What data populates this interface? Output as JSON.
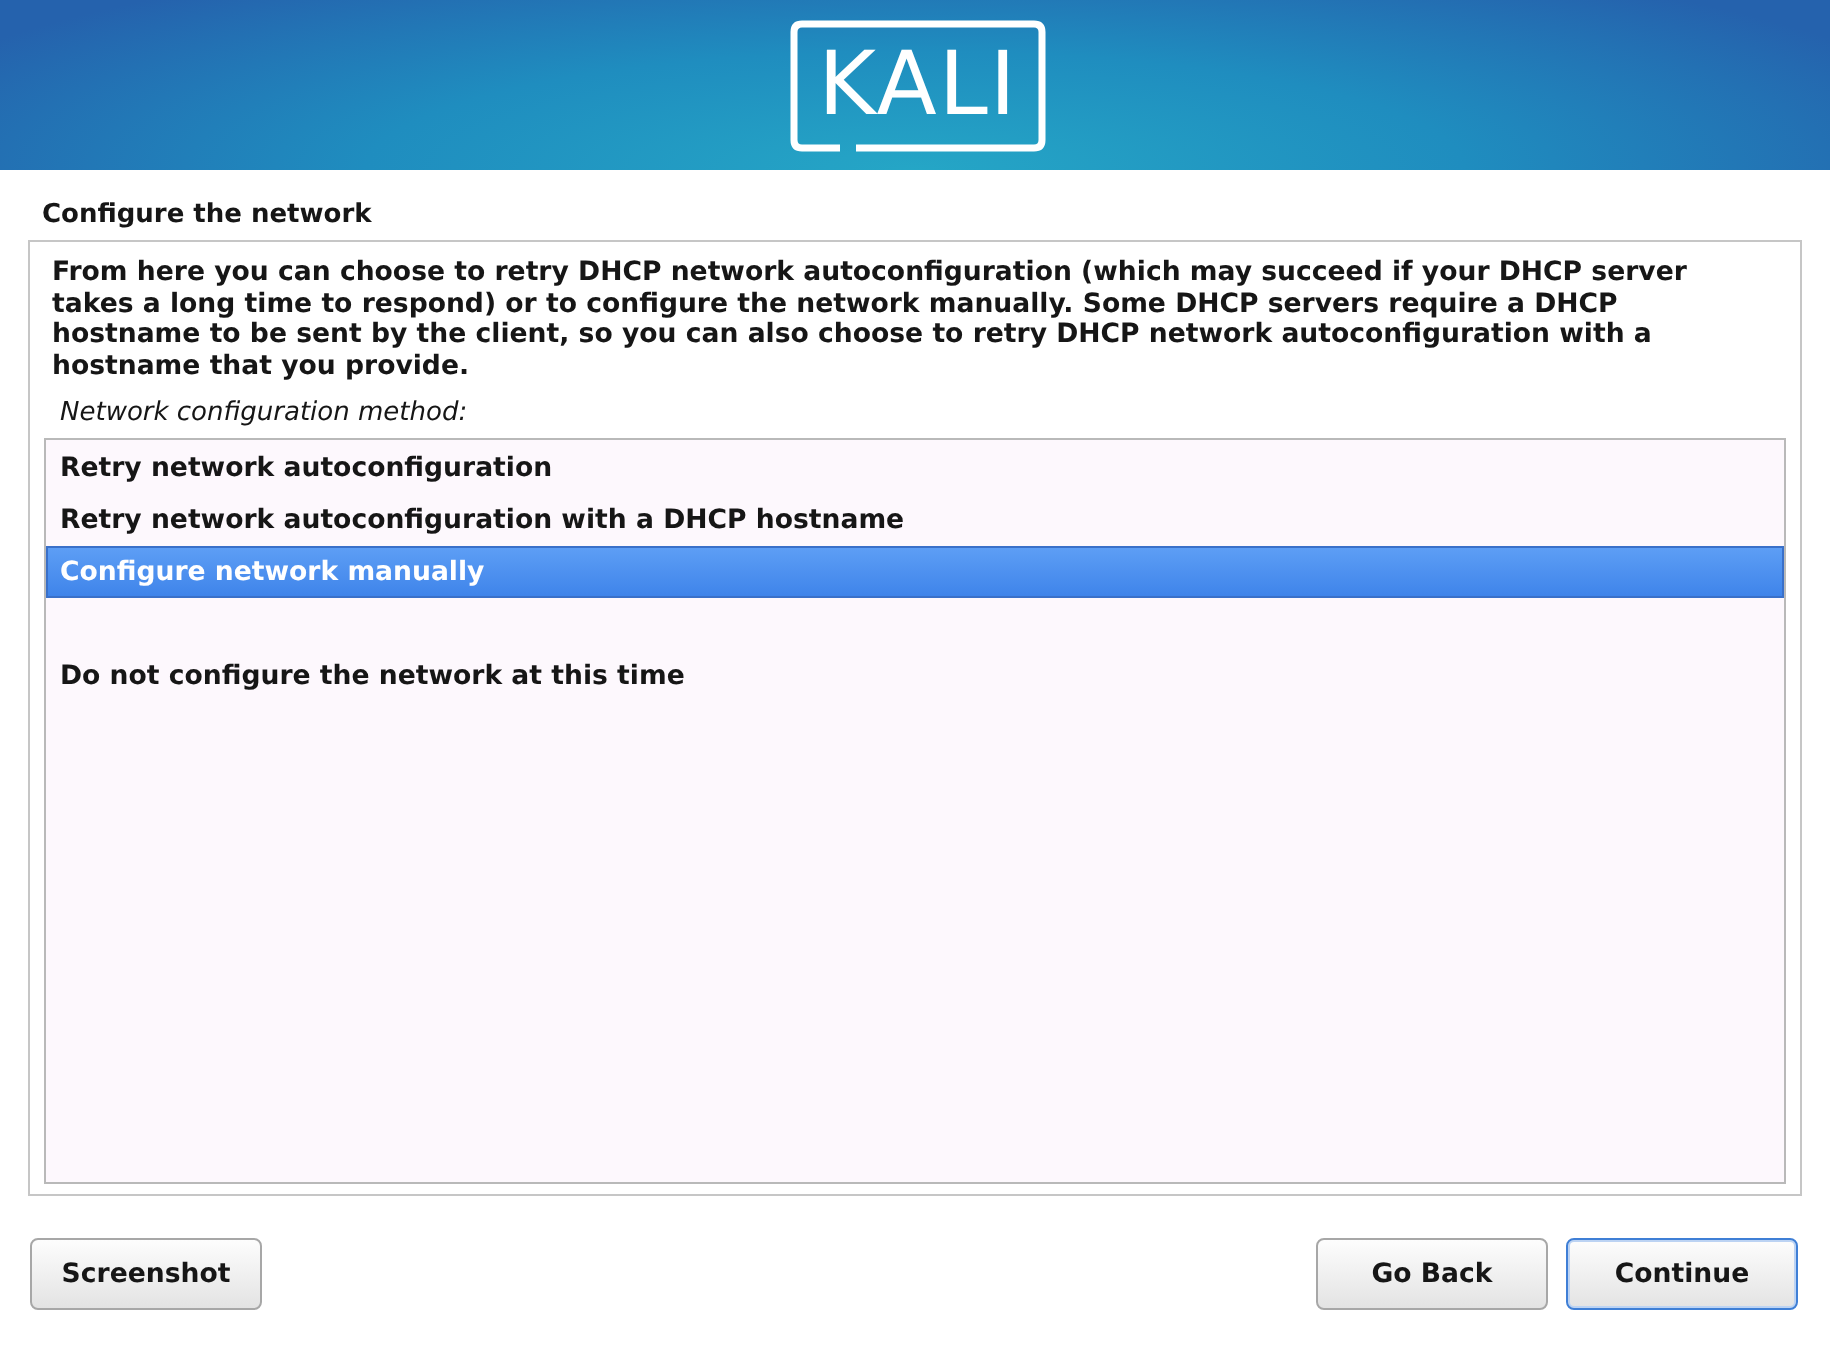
{
  "header": {
    "logo": "KALI"
  },
  "page_title": "Configure the network",
  "description": "From here you can choose to retry DHCP network autoconfiguration (which may succeed if your DHCP server takes a long time to respond) or to configure the network manually. Some DHCP servers require a DHCP hostname to be sent by the client, so you can also choose to retry DHCP network autoconfiguration with a hostname that you provide.",
  "list_label": "Network configuration method:",
  "option_groups": [
    [
      {
        "label": "Retry network autoconfiguration",
        "selected": false
      },
      {
        "label": "Retry network autoconfiguration with a DHCP hostname",
        "selected": false
      },
      {
        "label": "Configure network manually",
        "selected": true
      }
    ],
    [
      {
        "label": "Do not configure the network at this time",
        "selected": false
      }
    ]
  ],
  "buttons_left": [
    {
      "label": "Screenshot",
      "focused": false
    }
  ],
  "buttons_right": [
    {
      "label": "Go Back",
      "focused": false
    },
    {
      "label": "Continue",
      "focused": true
    }
  ]
}
